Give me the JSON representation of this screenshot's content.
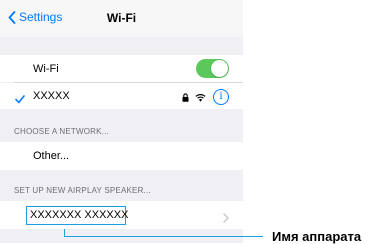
{
  "navbar": {
    "back_label": "Settings",
    "title": "Wi-Fi"
  },
  "wifi": {
    "label": "Wi-Fi",
    "enabled": true
  },
  "connected_network": {
    "name": "XXXXX",
    "secured": true
  },
  "choose_network": {
    "header": "CHOOSE A NETWORK...",
    "other_label": "Other..."
  },
  "airplay": {
    "header": "SET UP NEW AIRPLAY SPEAKER...",
    "device_name": "XXXXXXX  XXXXXX"
  },
  "annotation": {
    "label": "Имя аппарата"
  },
  "colors": {
    "accent": "#007aff",
    "toggle_on": "#5ac85a",
    "callout": "#1aa0e0"
  },
  "icons": [
    "chevron-left-icon",
    "checkmark-icon",
    "lock-icon",
    "wifi-signal-icon",
    "info-icon",
    "chevron-right-icon"
  ]
}
